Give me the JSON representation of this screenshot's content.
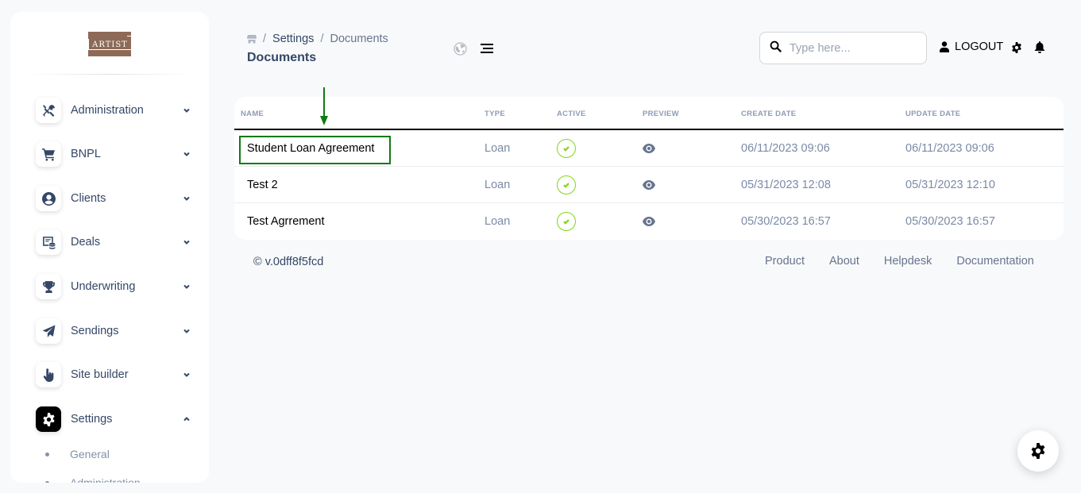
{
  "sidebar": {
    "logo_text": "ARTIST",
    "items": [
      {
        "label": "Administration",
        "icon": "tools-icon",
        "expanded": false
      },
      {
        "label": "BNPL",
        "icon": "cart-icon",
        "expanded": false
      },
      {
        "label": "Clients",
        "icon": "user-circle-icon",
        "expanded": false
      },
      {
        "label": "Deals",
        "icon": "deals-icon",
        "expanded": false
      },
      {
        "label": "Underwriting",
        "icon": "trophy-icon",
        "expanded": false
      },
      {
        "label": "Sendings",
        "icon": "paper-plane-icon",
        "expanded": false
      },
      {
        "label": "Site builder",
        "icon": "pointer-hand-icon",
        "expanded": false
      },
      {
        "label": "Settings",
        "icon": "gear-icon",
        "expanded": true
      }
    ],
    "sub_items": [
      "General",
      "Administration"
    ]
  },
  "header": {
    "breadcrumb": [
      "Settings",
      "Documents"
    ],
    "title": "Documents",
    "search_placeholder": "Type here...",
    "logout_label": "LOGOUT"
  },
  "table": {
    "columns": [
      "Name",
      "Type",
      "Active",
      "Preview",
      "Create date",
      "Update date"
    ],
    "rows": [
      {
        "name": "Student Loan Agreement",
        "type": "Loan",
        "active": true,
        "create_date": "06/11/2023 09:06",
        "update_date": "06/11/2023 09:06"
      },
      {
        "name": "Test 2",
        "type": "Loan",
        "active": true,
        "create_date": "05/31/2023 12:08",
        "update_date": "05/31/2023 12:10"
      },
      {
        "name": "Test Agrrement",
        "type": "Loan",
        "active": true,
        "create_date": "05/30/2023 16:57",
        "update_date": "05/30/2023 16:57"
      }
    ]
  },
  "footer": {
    "copyright": "© v.0dff8f5fcd",
    "links": [
      "Product",
      "About",
      "Helpdesk",
      "Documentation"
    ]
  },
  "colors": {
    "active_check": "#82d616",
    "highlight": "#117a11",
    "text_dark": "#344767"
  }
}
